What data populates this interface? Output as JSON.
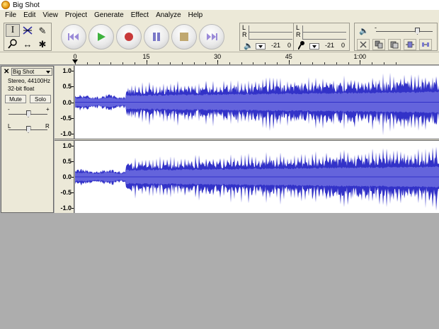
{
  "window": {
    "title": "Big Shot"
  },
  "menu": [
    "File",
    "Edit",
    "View",
    "Project",
    "Generate",
    "Effect",
    "Analyze",
    "Help"
  ],
  "tools": [
    {
      "name": "selection-tool",
      "glyph": "I"
    },
    {
      "name": "envelope-tool",
      "glyph": "⋈"
    },
    {
      "name": "draw-tool",
      "glyph": "✎"
    },
    {
      "name": "zoom-tool",
      "glyph": "⚲"
    },
    {
      "name": "timeshift-tool",
      "glyph": "↔"
    },
    {
      "name": "multi-tool",
      "glyph": "✱"
    }
  ],
  "transport": [
    {
      "name": "skip-to-start-button",
      "icon": "skip-start-icon"
    },
    {
      "name": "play-button",
      "icon": "play-icon"
    },
    {
      "name": "record-button",
      "icon": "record-icon"
    },
    {
      "name": "pause-button",
      "icon": "pause-icon"
    },
    {
      "name": "stop-button",
      "icon": "stop-icon"
    },
    {
      "name": "skip-to-end-button",
      "icon": "skip-end-icon"
    }
  ],
  "playback_meter": {
    "left": "L",
    "right": "R",
    "min": "-21",
    "max": "0"
  },
  "record_meter": {
    "left": "L",
    "right": "R",
    "min": "-21",
    "max": "0"
  },
  "ruler": {
    "labels": [
      "0",
      "15",
      "30",
      "45",
      "1:00"
    ],
    "seconds": [
      0,
      15,
      30,
      45,
      60
    ],
    "max_seconds": 68
  },
  "track": {
    "name": "Big Shot",
    "info_line1": "Stereo, 44100Hz",
    "info_line2": "32-bit float",
    "mute_label": "Mute",
    "solo_label": "Solo",
    "gain_minus": "-",
    "gain_plus": "+",
    "pan_left": "L",
    "pan_right": "R",
    "gain_level": 0.5,
    "pan_level": 0.5
  },
  "amplitude_labels": [
    "1.0",
    "0.5",
    "0.0",
    "-0.5",
    "-1.0"
  ],
  "colors": {
    "waveform": "#3232c8",
    "waveform_rms": "#6464dc",
    "background": "#adadad",
    "toolbar": "#ece9d8"
  }
}
